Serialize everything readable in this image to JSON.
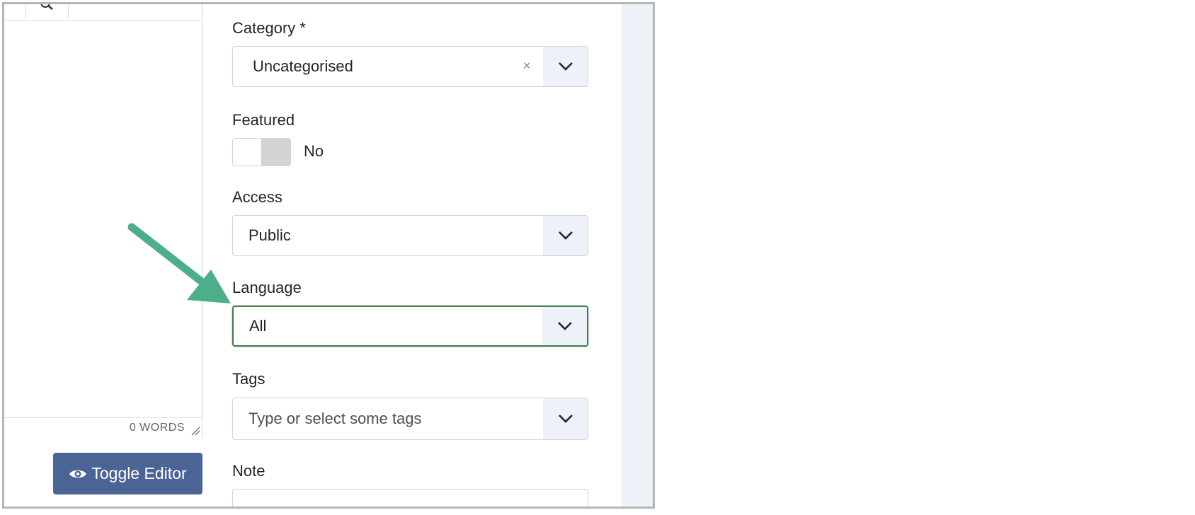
{
  "editor": {
    "word_count": "0 WORDS",
    "toggle_editor_label": "Toggle Editor",
    "toolbar_icons": [
      "search-icon"
    ]
  },
  "form": {
    "category": {
      "label": "Category *",
      "value": "Uncategorised",
      "clear": "×"
    },
    "featured": {
      "label": "Featured",
      "state": "No"
    },
    "access": {
      "label": "Access",
      "value": "Public"
    },
    "language": {
      "label": "Language",
      "value": "All"
    },
    "tags": {
      "label": "Tags",
      "placeholder": "Type or select some tags"
    },
    "note": {
      "label": "Note",
      "value": ""
    }
  },
  "colors": {
    "toggle_button_bg": "#4a6495",
    "focus_border": "#457d54",
    "arrow": "#4caf89",
    "caret_bg": "#eef1f7"
  }
}
